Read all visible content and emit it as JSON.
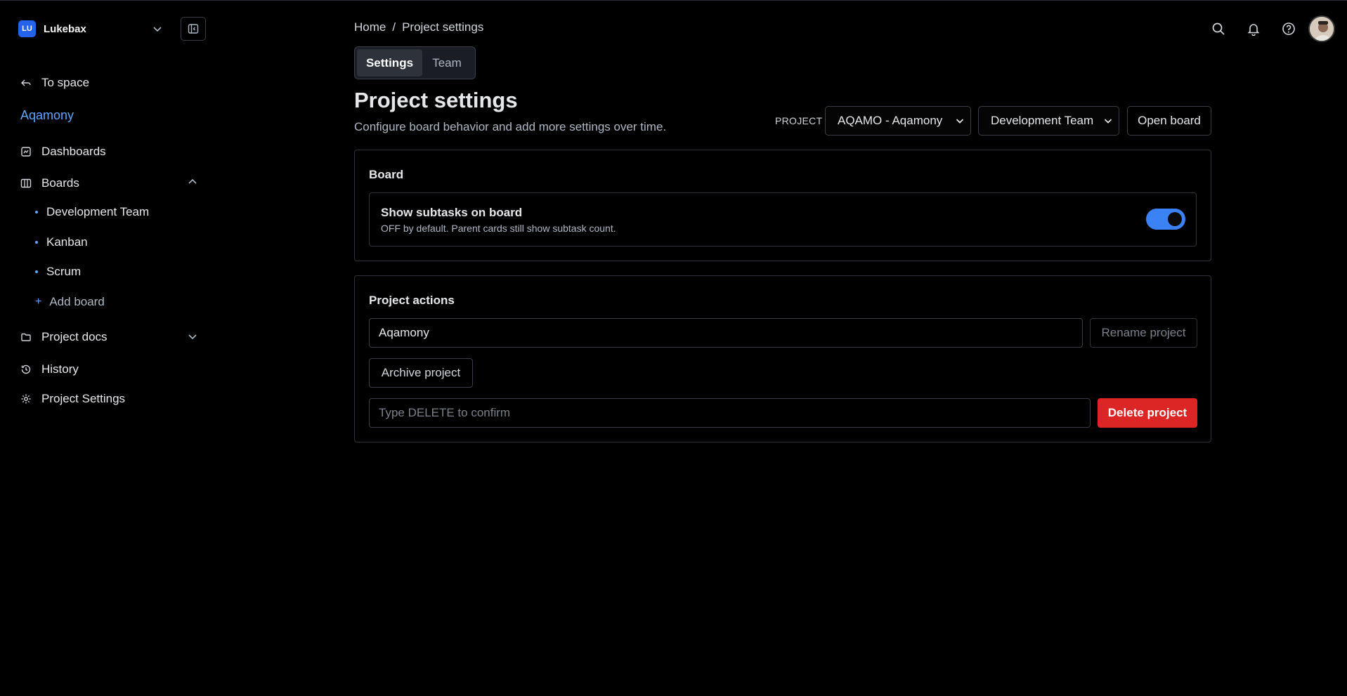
{
  "workspace": {
    "badge": "LU",
    "name": "Lukebax"
  },
  "sidebar": {
    "back_label": "To space",
    "project_name": "Aqamony",
    "dashboards": "Dashboards",
    "boards": "Boards",
    "board_items": [
      "Development Team",
      "Kanban",
      "Scrum"
    ],
    "add_board": "Add board",
    "project_docs": "Project docs",
    "history": "History",
    "project_settings": "Project Settings"
  },
  "breadcrumb": {
    "home": "Home",
    "separator": "/",
    "current": "Project settings"
  },
  "tabs": {
    "settings": "Settings",
    "team": "Team"
  },
  "page": {
    "title": "Project settings",
    "subtitle": "Configure board behavior and add more settings over time."
  },
  "selectors": {
    "label": "PROJECT",
    "project_value": "AQAMO - Aqamony",
    "board_value": "Development Team",
    "open_board": "Open board"
  },
  "board_card": {
    "title": "Board",
    "setting_title": "Show subtasks on board",
    "setting_desc": "OFF by default. Parent cards still show subtask count.",
    "toggle_on": true
  },
  "actions_card": {
    "title": "Project actions",
    "name_value": "Aqamony",
    "rename_label": "Rename project",
    "archive_label": "Archive project",
    "delete_placeholder": "Type DELETE to confirm",
    "delete_label": "Delete project"
  },
  "colors": {
    "accent": "#60a5fa",
    "toggle": "#3b82f6",
    "danger": "#dc2626",
    "workspace_badge": "#2563eb"
  },
  "icons": [
    "arrow-left-icon",
    "dashboard-icon",
    "board-columns-icon",
    "folder-icon",
    "history-icon",
    "gear-icon",
    "search-icon",
    "bell-icon",
    "help-icon",
    "sidebar-collapse-icon",
    "chevron-down-icon",
    "chevron-up-icon"
  ]
}
